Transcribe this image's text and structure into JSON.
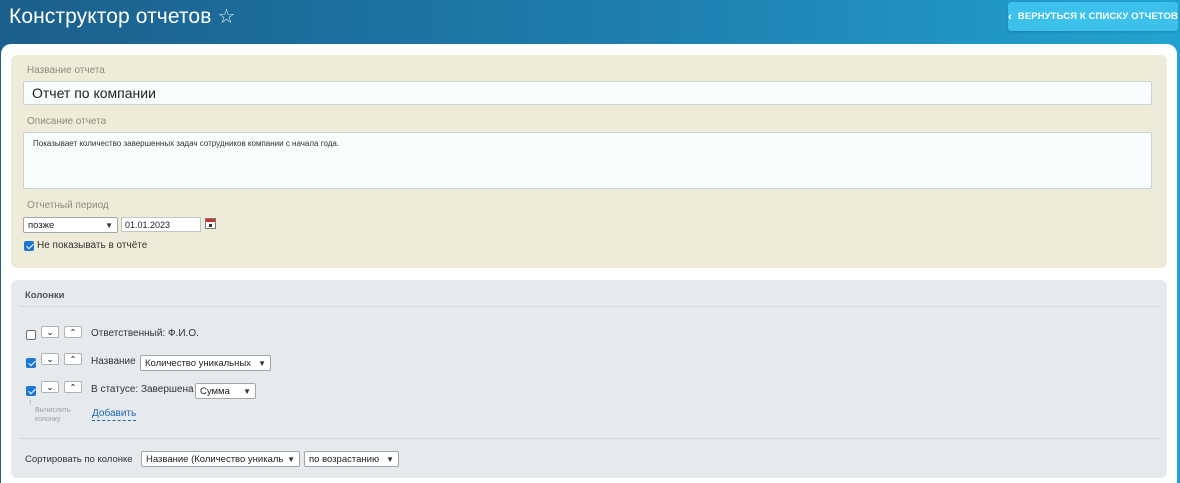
{
  "header": {
    "title": "Конструктор отчетов",
    "star_icon": "☆",
    "back_button_label": "ВЕРНУТЬСЯ К СПИСКУ ОТЧЕТОВ",
    "back_chevron": "‹"
  },
  "report": {
    "name_label": "Название отчета",
    "name_value": "Отчет по компании",
    "description_label": "Описание отчета",
    "description_value": "Показывает количество завершенных задач сотрудников компании с начала года.",
    "period_label": "Отчетный период",
    "period_mode": "позже",
    "period_date": "01.01.2023",
    "hide_checkbox_label": "Не показывать в отчёте",
    "hide_checked": true
  },
  "columns": {
    "heading": "Колонки",
    "rows": [
      {
        "checked": false,
        "label": "Ответственный: Ф.И.О.",
        "select": ""
      },
      {
        "checked": true,
        "label": "Название",
        "select": "Количество уникальных"
      },
      {
        "checked": true,
        "label": "В статусе: Завершена",
        "select": "Сумма"
      }
    ],
    "move_down_icon": "⌄",
    "move_up_icon": "⌃",
    "calc_hint_line1": "Вычислить",
    "calc_hint_line2": "колонку",
    "calc_arrow": "↑",
    "add_link": "Добавить"
  },
  "sorting": {
    "label": "Сортировать по колонке",
    "column_value": "Название (Количество уникальн",
    "order_value": "по возрастанию"
  },
  "colors": {
    "header_gradient_start": "#1b5f8c",
    "header_gradient_end": "#22a3cf",
    "back_button": "#3bc1ec",
    "settings_panel": "#eeecd8",
    "columns_panel": "#e6eaec",
    "link": "#2067b0",
    "checkbox": "#1d76d2"
  }
}
